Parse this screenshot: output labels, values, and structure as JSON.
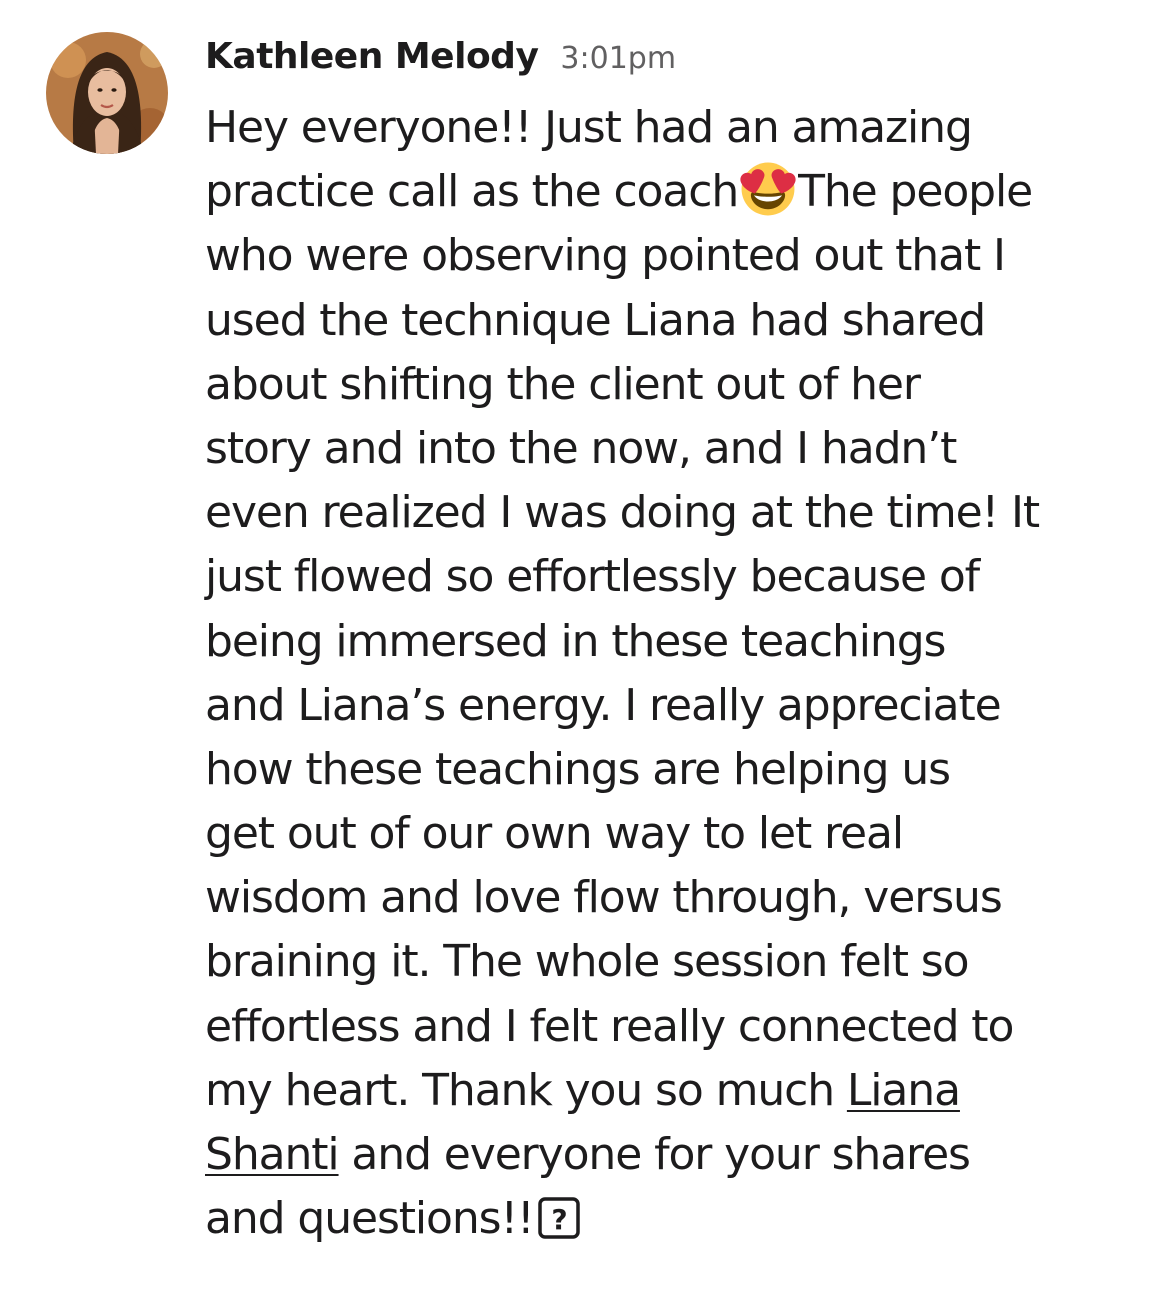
{
  "message": {
    "author": "Kathleen Melody",
    "timestamp": "3:01pm",
    "avatar_icon": "user-avatar-photo",
    "emoji_icon": "heart-eyes-emoji-icon",
    "unknown_glyph_icon": "missing-glyph-icon",
    "unknown_glyph_char": "?",
    "lines": [
      "Hey everyone!! Just had an amazing",
      "practice call as the coach",
      "The people",
      "who were observing pointed out that I",
      "used the technique Liana had shared",
      "about shifting the client out of her",
      "story and into the now, and I hadn’t",
      "even realized I was doing at the time! It",
      "just flowed so effortlessly because of",
      "being immersed in these teachings",
      "and Liana’s energy. I really appreciate",
      "how these teachings are helping us",
      "get out of our own way to let real",
      "wisdom and love flow through, versus",
      "braining it. The whole session felt so",
      "effortless and I felt really connected to",
      "my heart. Thank you so much ",
      "Liana",
      "Shanti",
      " and everyone for your shares",
      "and questions!!"
    ],
    "mention": "Liana Shanti"
  },
  "colors": {
    "text": "#1d1c1d",
    "timestamp": "#616061",
    "background": "#ffffff",
    "emoji_face": "#ffcc4d",
    "emoji_hearts": "#dd2e44"
  }
}
